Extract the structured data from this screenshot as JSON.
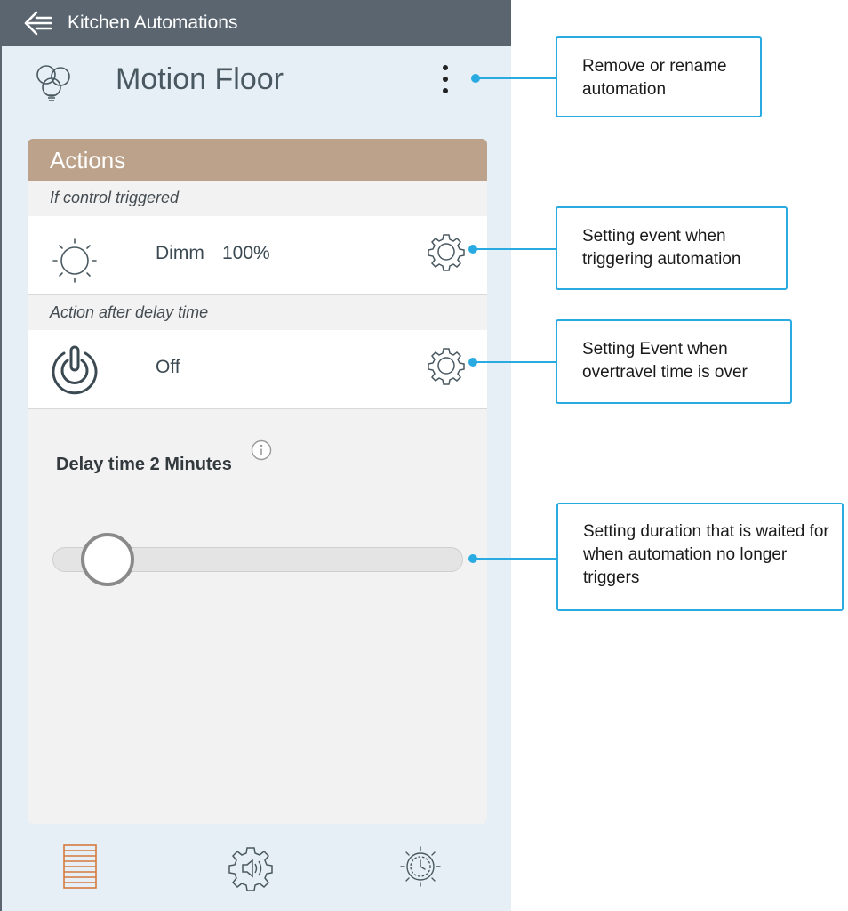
{
  "app": {
    "back_title": "Kitchen Automations",
    "automation_name": "Motion Floor"
  },
  "actions": {
    "header": "Actions",
    "triggered_label": "If control triggered",
    "triggered_action": {
      "name": "Dimm",
      "value": "100%"
    },
    "delay_label": "Action after delay time",
    "delay_action": {
      "name": "Off"
    }
  },
  "delay": {
    "label": "Delay time 2 Minutes",
    "slider_fraction": 0.08
  },
  "bottom_nav": {
    "items": [
      "blinds-icon",
      "gear-sound-icon",
      "sun-clock-icon"
    ]
  },
  "annotations": {
    "menu": "Remove or rename automation",
    "trigger_event": "Setting event when triggering automation",
    "delay_event": "Setting Event when overtravel time is over",
    "delay_duration": "Setting duration that is waited for when automation no longer triggers"
  },
  "colors": {
    "topbar": "#5a6570",
    "panel_bg": "#e6eef6",
    "actions_header": "#bca28a",
    "callout": "#29abe2",
    "active_tab": "#d67a3f"
  }
}
